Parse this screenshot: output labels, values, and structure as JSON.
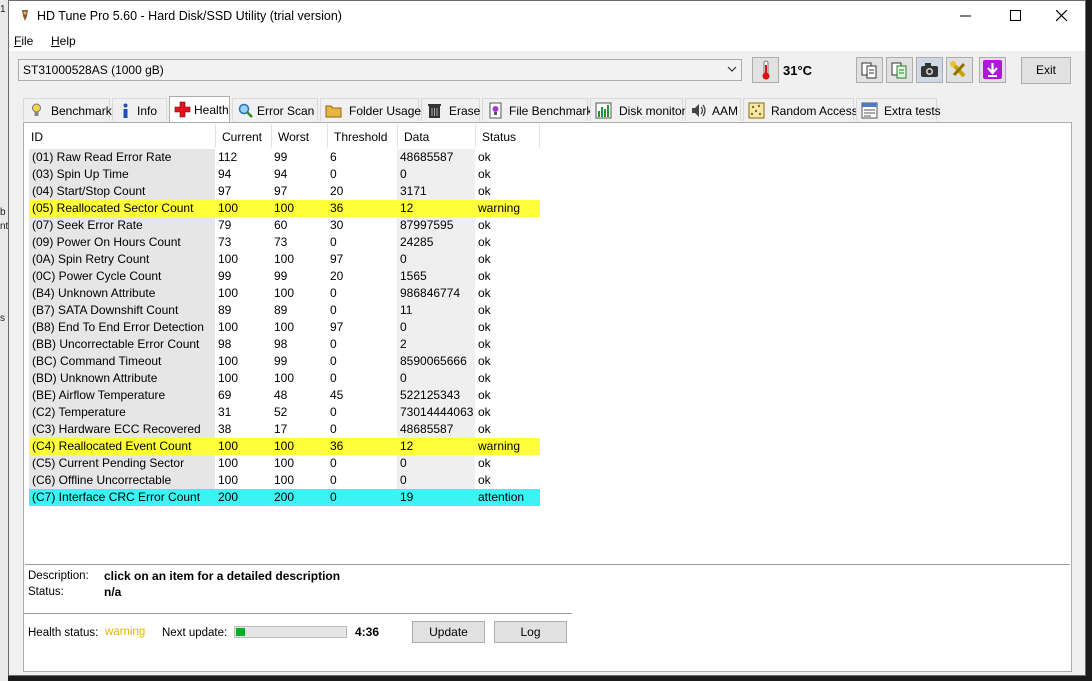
{
  "window": {
    "title": "HD Tune Pro 5.60 - Hard Disk/SSD Utility (trial version)"
  },
  "menu": [
    {
      "first": "F",
      "rest": "ile"
    },
    {
      "first": "H",
      "rest": "elp"
    }
  ],
  "toolbar": {
    "drive": "ST31000528AS (1000 gB)",
    "temperature": "31°C",
    "exit_label": "Exit"
  },
  "tabs": [
    {
      "label": "Benchmark",
      "icon": "benchmark-icon"
    },
    {
      "label": "Info",
      "icon": "info-icon"
    },
    {
      "label": "Health",
      "icon": "health-cross-icon",
      "active": true
    },
    {
      "label": "Error Scan",
      "icon": "magnifier-icon"
    },
    {
      "label": "Folder Usage",
      "icon": "folder-icon"
    },
    {
      "label": "Erase",
      "icon": "trash-icon"
    },
    {
      "label": "File Benchmark",
      "icon": "file-benchmark-icon"
    },
    {
      "label": "Disk monitor",
      "icon": "disk-monitor-icon"
    },
    {
      "label": "AAM",
      "icon": "speaker-icon"
    },
    {
      "label": "Random Access",
      "icon": "random-access-icon"
    },
    {
      "label": "Extra tests",
      "icon": "extra-tests-icon"
    }
  ],
  "health_table": {
    "columns": [
      "ID",
      "Current",
      "Worst",
      "Threshold",
      "Data",
      "Status"
    ],
    "rows": [
      {
        "id": "(01) Raw Read Error Rate",
        "current": "112",
        "worst": "99",
        "threshold": "6",
        "data": "48685587",
        "status": "ok"
      },
      {
        "id": "(03) Spin Up Time",
        "current": "94",
        "worst": "94",
        "threshold": "0",
        "data": "0",
        "status": "ok"
      },
      {
        "id": "(04) Start/Stop Count",
        "current": "97",
        "worst": "97",
        "threshold": "20",
        "data": "3171",
        "status": "ok"
      },
      {
        "id": "(05) Reallocated Sector Count",
        "current": "100",
        "worst": "100",
        "threshold": "36",
        "data": "12",
        "status": "warning"
      },
      {
        "id": "(07) Seek Error Rate",
        "current": "79",
        "worst": "60",
        "threshold": "30",
        "data": "87997595",
        "status": "ok"
      },
      {
        "id": "(09) Power On Hours Count",
        "current": "73",
        "worst": "73",
        "threshold": "0",
        "data": "24285",
        "status": "ok"
      },
      {
        "id": "(0A) Spin Retry Count",
        "current": "100",
        "worst": "100",
        "threshold": "97",
        "data": "0",
        "status": "ok"
      },
      {
        "id": "(0C) Power Cycle Count",
        "current": "99",
        "worst": "99",
        "threshold": "20",
        "data": "1565",
        "status": "ok"
      },
      {
        "id": "(B4) Unknown Attribute",
        "current": "100",
        "worst": "100",
        "threshold": "0",
        "data": "986846774",
        "status": "ok"
      },
      {
        "id": "(B7) SATA Downshift Count",
        "current": "89",
        "worst": "89",
        "threshold": "0",
        "data": "11",
        "status": "ok"
      },
      {
        "id": "(B8) End To End Error Detection",
        "current": "100",
        "worst": "100",
        "threshold": "97",
        "data": "0",
        "status": "ok"
      },
      {
        "id": "(BB) Uncorrectable Error Count",
        "current": "98",
        "worst": "98",
        "threshold": "0",
        "data": "2",
        "status": "ok"
      },
      {
        "id": "(BC) Command Timeout",
        "current": "100",
        "worst": "99",
        "threshold": "0",
        "data": "8590065666",
        "status": "ok"
      },
      {
        "id": "(BD) Unknown Attribute",
        "current": "100",
        "worst": "100",
        "threshold": "0",
        "data": "0",
        "status": "ok"
      },
      {
        "id": "(BE) Airflow Temperature",
        "current": "69",
        "worst": "48",
        "threshold": "45",
        "data": "522125343",
        "status": "ok"
      },
      {
        "id": "(C2) Temperature",
        "current": "31",
        "worst": "52",
        "threshold": "0",
        "data": "73014444063",
        "status": "ok"
      },
      {
        "id": "(C3) Hardware ECC Recovered",
        "current": "38",
        "worst": "17",
        "threshold": "0",
        "data": "48685587",
        "status": "ok"
      },
      {
        "id": "(C4) Reallocated Event Count",
        "current": "100",
        "worst": "100",
        "threshold": "36",
        "data": "12",
        "status": "warning"
      },
      {
        "id": "(C5) Current Pending Sector",
        "current": "100",
        "worst": "100",
        "threshold": "0",
        "data": "0",
        "status": "ok"
      },
      {
        "id": "(C6) Offline Uncorrectable",
        "current": "100",
        "worst": "100",
        "threshold": "0",
        "data": "0",
        "status": "ok"
      },
      {
        "id": "(C7) Interface CRC Error Count",
        "current": "200",
        "worst": "200",
        "threshold": "0",
        "data": "19",
        "status": "attention"
      }
    ]
  },
  "details": {
    "description_label": "Description:",
    "description_value": "click on an item for a detailed description",
    "status_label": "Status:",
    "status_value": "n/a"
  },
  "footer": {
    "health_status_label": "Health status:",
    "health_status_value": "warning",
    "next_update_label": "Next update:",
    "next_update_progress": 0.08,
    "next_update_time": "4:36",
    "update_button": "Update",
    "log_button": "Log"
  },
  "colors": {
    "warning_row": "#ffff3a",
    "attention_row": "#3cf2f2",
    "health_warning_text": "#e2b400",
    "progress_fill": "#06b025"
  }
}
